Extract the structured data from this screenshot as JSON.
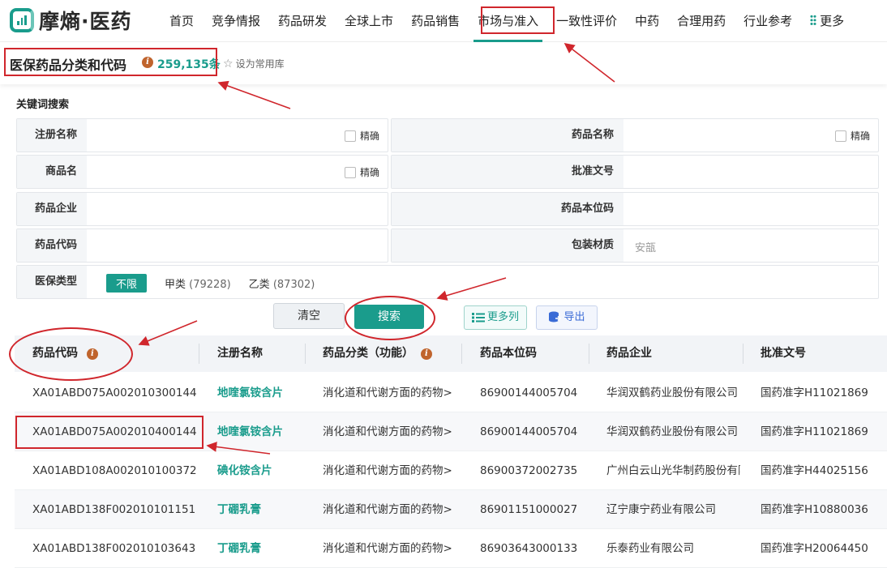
{
  "app": {
    "logo_text": "摩熵·医药"
  },
  "nav": {
    "items": [
      {
        "label": "首页"
      },
      {
        "label": "竞争情报"
      },
      {
        "label": "药品研发"
      },
      {
        "label": "全球上市"
      },
      {
        "label": "药品销售"
      },
      {
        "label": "市场与准入",
        "active": true
      },
      {
        "label": "一致性评价"
      },
      {
        "label": "中药"
      },
      {
        "label": "合理用药"
      },
      {
        "label": "行业参考"
      }
    ],
    "more_label": "更多"
  },
  "page": {
    "title": "医保药品分类和代码",
    "count": "259,135条",
    "favorite_label": "设为常用库"
  },
  "search": {
    "section_label": "关键词搜索",
    "exact_label": "精确",
    "fields": {
      "reg_name": "注册名称",
      "drug_name": "药品名称",
      "trade_name": "商品名",
      "approval_no": "批准文号",
      "company": "药品企业",
      "standard_code": "药品本位码",
      "drug_code": "药品代码",
      "packaging": "包装材质",
      "packaging_placeholder": "安瓿",
      "insurance_type": "医保类型"
    },
    "insurance_options": {
      "unlimited": "不限",
      "class_a": "甲类",
      "class_a_count": "(79228)",
      "class_b": "乙类",
      "class_b_count": "(87302)"
    },
    "buttons": {
      "clear": "清空",
      "search": "搜索",
      "more_columns": "更多列",
      "export": "导出"
    }
  },
  "table": {
    "headers": {
      "code": "药品代码",
      "reg_name": "注册名称",
      "category": "药品分类（功能）",
      "standard_code": "药品本位码",
      "company": "药品企业",
      "approval": "批准文号"
    },
    "rows": [
      {
        "code": "XA01ABD075A002010300144",
        "reg_name": "地喹氯铵含片",
        "category": "消化道和代谢方面的药物>",
        "standard_code": "86900144005704",
        "company": "华润双鹤药业股份有限公司",
        "approval": "国药准字H11021869"
      },
      {
        "code": "XA01ABD075A002010400144",
        "reg_name": "地喹氯铵含片",
        "category": "消化道和代谢方面的药物>",
        "standard_code": "86900144005704",
        "company": "华润双鹤药业股份有限公司",
        "approval": "国药准字H11021869"
      },
      {
        "code": "XA01ABD108A002010100372",
        "reg_name": "碘化铵含片",
        "category": "消化道和代谢方面的药物>",
        "standard_code": "86900372002735",
        "company": "广州白云山光华制药股份有限公司",
        "approval": "国药准字H44025156"
      },
      {
        "code": "XA01ABD138F002010101151",
        "reg_name": "丁硼乳膏",
        "category": "消化道和代谢方面的药物>",
        "standard_code": "86901151000027",
        "company": "辽宁康宁药业有限公司",
        "approval": "国药准字H10880036"
      },
      {
        "code": "XA01ABD138F002010103643",
        "reg_name": "丁硼乳膏",
        "category": "消化道和代谢方面的药物>",
        "standard_code": "86903643000133",
        "company": "乐泰药业有限公司",
        "approval": "国药准字H20064450"
      }
    ]
  },
  "colors": {
    "accent": "#1a9c8c",
    "annotation": "#d0262c",
    "info": "#c0642d"
  }
}
